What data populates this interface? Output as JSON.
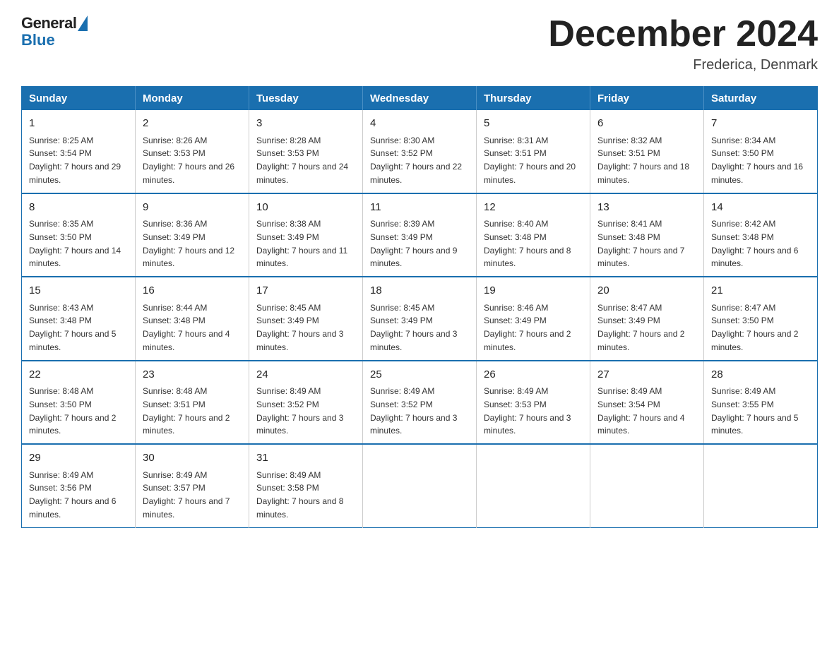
{
  "header": {
    "logo_general": "General",
    "logo_blue": "Blue",
    "month_title": "December 2024",
    "location": "Frederica, Denmark"
  },
  "days_of_week": [
    "Sunday",
    "Monday",
    "Tuesday",
    "Wednesday",
    "Thursday",
    "Friday",
    "Saturday"
  ],
  "weeks": [
    [
      {
        "day": "1",
        "sunrise": "8:25 AM",
        "sunset": "3:54 PM",
        "daylight": "7 hours and 29 minutes."
      },
      {
        "day": "2",
        "sunrise": "8:26 AM",
        "sunset": "3:53 PM",
        "daylight": "7 hours and 26 minutes."
      },
      {
        "day": "3",
        "sunrise": "8:28 AM",
        "sunset": "3:53 PM",
        "daylight": "7 hours and 24 minutes."
      },
      {
        "day": "4",
        "sunrise": "8:30 AM",
        "sunset": "3:52 PM",
        "daylight": "7 hours and 22 minutes."
      },
      {
        "day": "5",
        "sunrise": "8:31 AM",
        "sunset": "3:51 PM",
        "daylight": "7 hours and 20 minutes."
      },
      {
        "day": "6",
        "sunrise": "8:32 AM",
        "sunset": "3:51 PM",
        "daylight": "7 hours and 18 minutes."
      },
      {
        "day": "7",
        "sunrise": "8:34 AM",
        "sunset": "3:50 PM",
        "daylight": "7 hours and 16 minutes."
      }
    ],
    [
      {
        "day": "8",
        "sunrise": "8:35 AM",
        "sunset": "3:50 PM",
        "daylight": "7 hours and 14 minutes."
      },
      {
        "day": "9",
        "sunrise": "8:36 AM",
        "sunset": "3:49 PM",
        "daylight": "7 hours and 12 minutes."
      },
      {
        "day": "10",
        "sunrise": "8:38 AM",
        "sunset": "3:49 PM",
        "daylight": "7 hours and 11 minutes."
      },
      {
        "day": "11",
        "sunrise": "8:39 AM",
        "sunset": "3:49 PM",
        "daylight": "7 hours and 9 minutes."
      },
      {
        "day": "12",
        "sunrise": "8:40 AM",
        "sunset": "3:48 PM",
        "daylight": "7 hours and 8 minutes."
      },
      {
        "day": "13",
        "sunrise": "8:41 AM",
        "sunset": "3:48 PM",
        "daylight": "7 hours and 7 minutes."
      },
      {
        "day": "14",
        "sunrise": "8:42 AM",
        "sunset": "3:48 PM",
        "daylight": "7 hours and 6 minutes."
      }
    ],
    [
      {
        "day": "15",
        "sunrise": "8:43 AM",
        "sunset": "3:48 PM",
        "daylight": "7 hours and 5 minutes."
      },
      {
        "day": "16",
        "sunrise": "8:44 AM",
        "sunset": "3:48 PM",
        "daylight": "7 hours and 4 minutes."
      },
      {
        "day": "17",
        "sunrise": "8:45 AM",
        "sunset": "3:49 PM",
        "daylight": "7 hours and 3 minutes."
      },
      {
        "day": "18",
        "sunrise": "8:45 AM",
        "sunset": "3:49 PM",
        "daylight": "7 hours and 3 minutes."
      },
      {
        "day": "19",
        "sunrise": "8:46 AM",
        "sunset": "3:49 PM",
        "daylight": "7 hours and 2 minutes."
      },
      {
        "day": "20",
        "sunrise": "8:47 AM",
        "sunset": "3:49 PM",
        "daylight": "7 hours and 2 minutes."
      },
      {
        "day": "21",
        "sunrise": "8:47 AM",
        "sunset": "3:50 PM",
        "daylight": "7 hours and 2 minutes."
      }
    ],
    [
      {
        "day": "22",
        "sunrise": "8:48 AM",
        "sunset": "3:50 PM",
        "daylight": "7 hours and 2 minutes."
      },
      {
        "day": "23",
        "sunrise": "8:48 AM",
        "sunset": "3:51 PM",
        "daylight": "7 hours and 2 minutes."
      },
      {
        "day": "24",
        "sunrise": "8:49 AM",
        "sunset": "3:52 PM",
        "daylight": "7 hours and 3 minutes."
      },
      {
        "day": "25",
        "sunrise": "8:49 AM",
        "sunset": "3:52 PM",
        "daylight": "7 hours and 3 minutes."
      },
      {
        "day": "26",
        "sunrise": "8:49 AM",
        "sunset": "3:53 PM",
        "daylight": "7 hours and 3 minutes."
      },
      {
        "day": "27",
        "sunrise": "8:49 AM",
        "sunset": "3:54 PM",
        "daylight": "7 hours and 4 minutes."
      },
      {
        "day": "28",
        "sunrise": "8:49 AM",
        "sunset": "3:55 PM",
        "daylight": "7 hours and 5 minutes."
      }
    ],
    [
      {
        "day": "29",
        "sunrise": "8:49 AM",
        "sunset": "3:56 PM",
        "daylight": "7 hours and 6 minutes."
      },
      {
        "day": "30",
        "sunrise": "8:49 AM",
        "sunset": "3:57 PM",
        "daylight": "7 hours and 7 minutes."
      },
      {
        "day": "31",
        "sunrise": "8:49 AM",
        "sunset": "3:58 PM",
        "daylight": "7 hours and 8 minutes."
      },
      null,
      null,
      null,
      null
    ]
  ]
}
